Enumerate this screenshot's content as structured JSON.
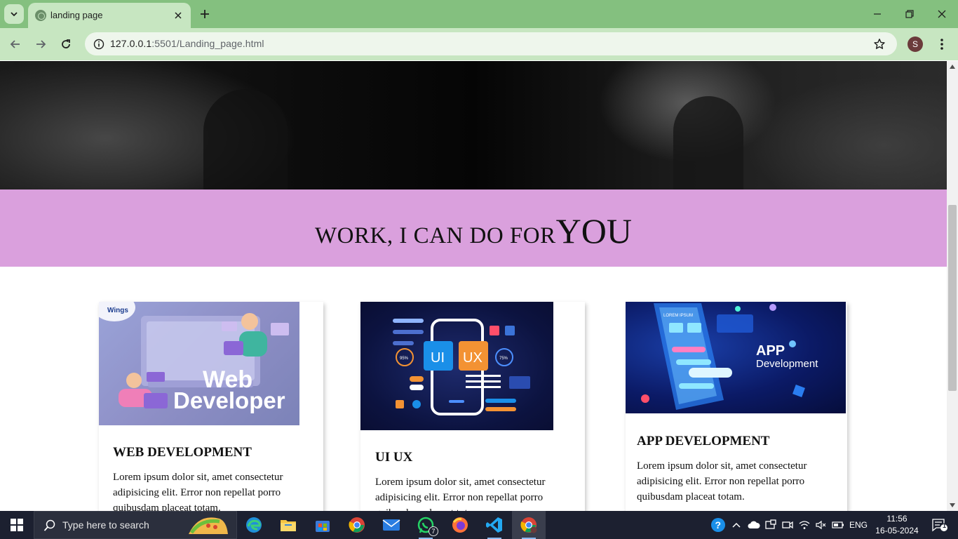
{
  "browser": {
    "tab_title": "landing page",
    "url_host": "127.0.0.1",
    "url_path": ":5501/Landing_page.html",
    "profile_initial": "S"
  },
  "page": {
    "section_heading_small": "WORK, I CAN DO FOR",
    "section_heading_big": "YOU",
    "cards": [
      {
        "image_label_line1": "Web",
        "image_label_line2": "Developer",
        "image_brand": "Wings",
        "title": "WEB DEVELOPMENT",
        "text": "Lorem ipsum dolor sit, amet consectetur adipisicing elit. Error non repellat porro quibusdam placeat totam."
      },
      {
        "image_label_line1": "UI",
        "image_label_line2": "UX",
        "image_stat1": "95%",
        "image_stat2": "75%",
        "title": "UI UX",
        "text": "Lorem ipsum dolor sit, amet consectetur adipisicing elit. Error non repellat porro quibusdam placeat totam."
      },
      {
        "image_label_line1": "APP",
        "image_label_line2": "Development",
        "image_mini": "LOREM IPSUM",
        "title": "APP DEVELOPMENT",
        "text": "Lorem ipsum dolor sit, amet consectetur adipisicing elit. Error non repellat porro quibusdam placeat totam."
      }
    ]
  },
  "taskbar": {
    "search_placeholder": "Type here to search",
    "whatsapp_badge": "7",
    "language": "ENG",
    "time": "11:56",
    "date": "16-05-2024",
    "notifications": "1"
  },
  "colors": {
    "tabbar": "#84c07f",
    "toolbar": "#c7e6c1",
    "band": "#daa0dd",
    "taskbar": "#1c2030"
  }
}
